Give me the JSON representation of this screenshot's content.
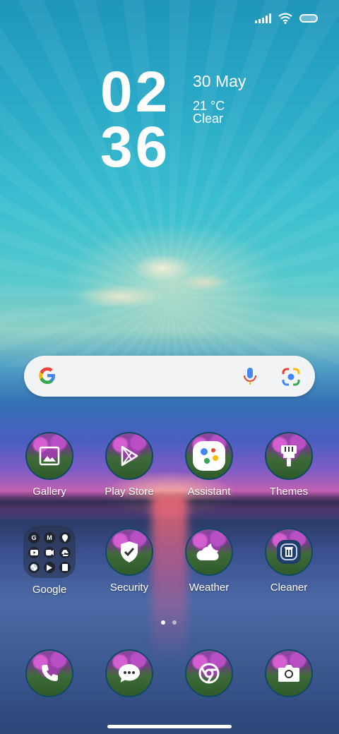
{
  "status_bar": {
    "icons": [
      "signal-icon",
      "wifi-icon",
      "battery-icon"
    ]
  },
  "clock": {
    "hours": "02",
    "minutes": "36",
    "date": "30 May",
    "temperature": "21 °C",
    "condition": "Clear"
  },
  "search_bar": {
    "logo": "google-g-icon",
    "voice_icon": "microphone-icon",
    "lens_icon": "google-lens-icon"
  },
  "apps_row1": [
    {
      "label": "Gallery",
      "icon": "gallery-icon"
    },
    {
      "label": "Play Store",
      "icon": "play-store-icon"
    },
    {
      "label": "Assistant",
      "icon": "assistant-icon"
    },
    {
      "label": "Themes",
      "icon": "themes-brush-icon"
    }
  ],
  "apps_row2": [
    {
      "label": "Google",
      "icon": "google-folder"
    },
    {
      "label": "Security",
      "icon": "shield-icon"
    },
    {
      "label": "Weather",
      "icon": "weather-icon"
    },
    {
      "label": "Cleaner",
      "icon": "cleaner-icon"
    }
  ],
  "google_folder": {
    "mini_apps": [
      "G",
      "M",
      "",
      "",
      "",
      "",
      "",
      "",
      ""
    ]
  },
  "page_indicator": {
    "pages": 2,
    "current": 1
  },
  "dock": [
    {
      "icon": "phone-icon"
    },
    {
      "icon": "messages-icon"
    },
    {
      "icon": "chrome-icon"
    },
    {
      "icon": "camera-icon"
    }
  ],
  "colors": {
    "search_bg": "#f1f3f4",
    "accent_teal": "#2aa9c7",
    "icon_ring": "#0e4a64"
  }
}
